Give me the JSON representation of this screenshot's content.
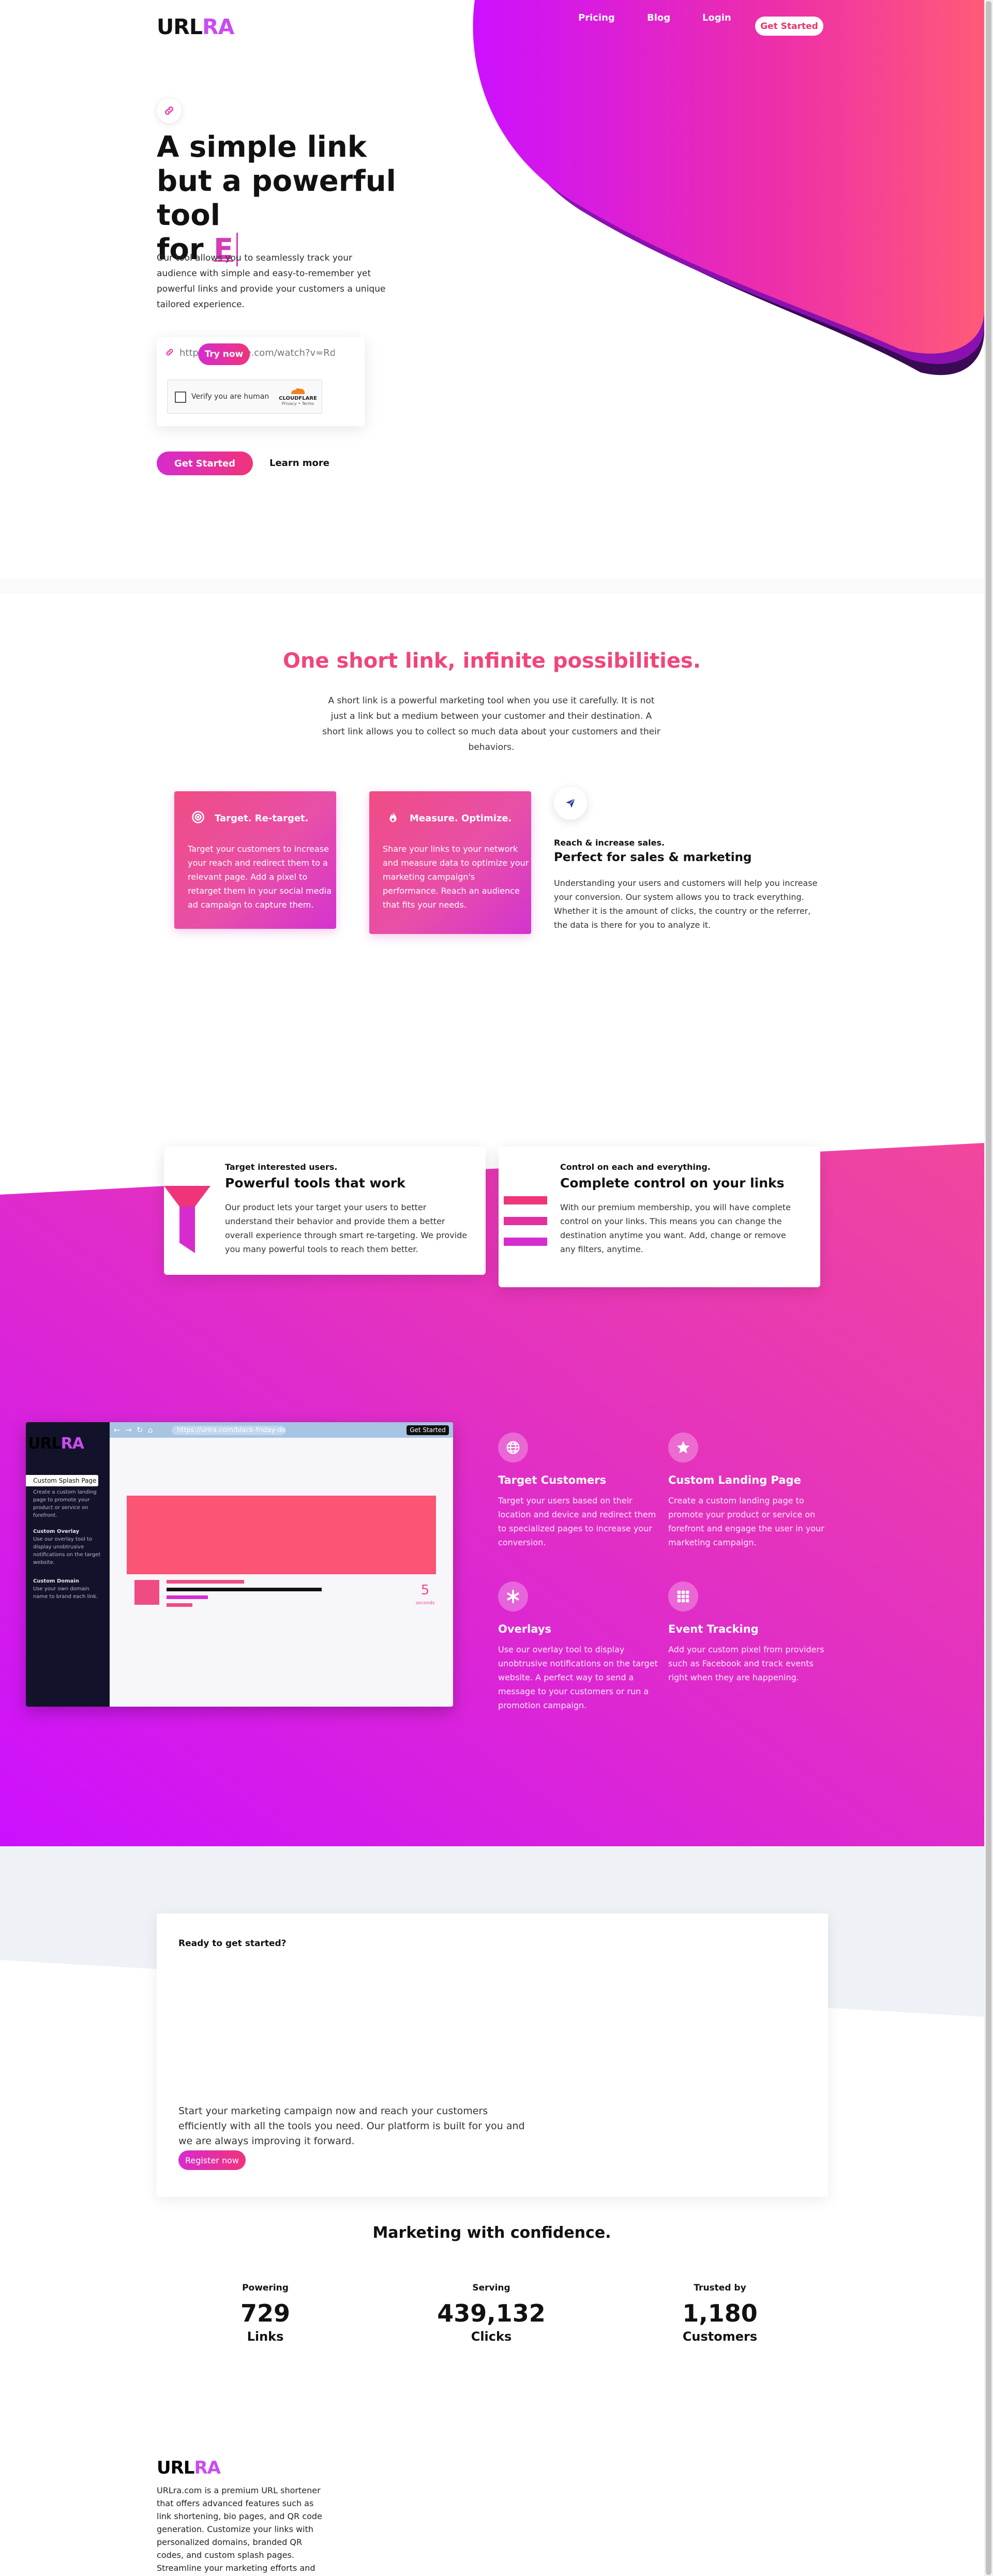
{
  "colors": {
    "pink": "#f0467a",
    "magenta": "#d62cce",
    "purple": "#c94cf0",
    "dark": "#111111"
  },
  "header": {
    "logo_part1": "URL",
    "logo_part2": "RA",
    "nav": [
      "Pricing",
      "Blog",
      "Login"
    ],
    "cta": "Get Started"
  },
  "hero": {
    "title_line1": "A simple link",
    "title_line2": "but a powerful tool",
    "title_line3_prefix": "for",
    "title_typed": "E",
    "description": "Our tool allows you to seamlessly track your audience with simple and easy-to-remember yet powerful links and provide your customers a unique tailored experience.",
    "input_placeholder": "https://youtube.com/watch?v=Rdb",
    "try_button": "Try now",
    "captcha_label": "Verify you are human",
    "captcha_brand": "CLOUDFLARE",
    "captcha_links": "Privacy • Terms",
    "primary_button": "Get Started",
    "secondary_link": "Learn more",
    "link_icon": "link-icon"
  },
  "possibilities": {
    "title": "One short link, infinite possibilities.",
    "description": "A short link is a powerful marketing tool when you use it carefully. It is not just a link but a medium between your customer and their destination. A short link allows you to collect so much data about your customers and their behaviors.",
    "cards": [
      {
        "icon": "target-icon",
        "title": "Target. Re-target.",
        "body": "Target your customers to increase your reach and redirect them to a relevant page. Add a pixel to retarget them in your social media ad campaign to capture them."
      },
      {
        "icon": "fire-icon",
        "title": "Measure. Optimize.",
        "body": "Share your links to your network and measure data to optimize your marketing campaign's performance. Reach an audience that fits your needs."
      }
    ],
    "sales": {
      "icon": "paper-plane-icon",
      "kicker": "Reach & increase sales.",
      "title": "Perfect for sales & marketing",
      "body": "Understanding your users and customers will help you increase your conversion. Our system allows you to track everything. Whether it is the amount of clicks, the country or the referrer, the data is there for you to analyze it."
    }
  },
  "tools": {
    "card1": {
      "kicker": "Target interested users.",
      "title": "Powerful tools that work",
      "body": "Our product lets your target your users to better understand their behavior and provide them a better overall experience through smart re-targeting. We provide you many powerful tools to reach them better.",
      "icon": "funnel-icon"
    },
    "card2": {
      "kicker": "Control on each and everything.",
      "title": "Complete control on your links",
      "body": "With our premium membership, you will have complete control on your links. This means you can change the destination anytime you want. Add, change or remove any filters, anytime.",
      "icon": "sliders-icon"
    }
  },
  "browser_mock": {
    "url": "https://urlra.com/black-friday-deals-link",
    "cta": "Get Started",
    "logo_part1": "URL",
    "logo_part2": "RA",
    "active_item": "Custom Splash Page",
    "active_desc": "Create a custom landing page to promote your product or service on forefront.",
    "items": [
      {
        "title": "Custom Overlay",
        "desc": "Use our overlay tool to display unobtrusive notifications on the target website."
      },
      {
        "title": "Custom Domain",
        "desc": "Use your own domain name to brand each link."
      }
    ],
    "countdown": "5",
    "countdown_label": "seconds"
  },
  "features": [
    {
      "icon": "globe-icon",
      "title": "Target Customers",
      "body": "Target your users based on their location and device and redirect them to specialized pages to increase your conversion."
    },
    {
      "icon": "star-icon",
      "title": "Custom Landing Page",
      "body": "Create a custom landing page to promote your product or service on forefront and engage the user in your marketing campaign."
    },
    {
      "icon": "asterisk-icon",
      "title": "Overlays",
      "body": "Use our overlay tool to display unobtrusive notifications on the target website. A perfect way to send a message to your customers or run a promotion campaign."
    },
    {
      "icon": "grid-icon",
      "title": "Event Tracking",
      "body": "Add your custom pixel from providers such as Facebook and track events right when they are happening."
    }
  ],
  "ready": {
    "kicker": "Ready to get started?",
    "body": "Start your marketing campaign now and reach your customers efficiently with all the tools you need. Our platform is built for you and we are always improving it forward.",
    "button": "Register now"
  },
  "stats": {
    "title": "Marketing with confidence.",
    "items": [
      {
        "label": "Powering",
        "value": "729",
        "unit": "Links"
      },
      {
        "label": "Serving",
        "value": "439,132",
        "unit": "Clicks"
      },
      {
        "label": "Trusted by",
        "value": "1,180",
        "unit": "Customers"
      }
    ]
  },
  "footer": {
    "logo_part1": "URL",
    "logo_part2": "RA",
    "description": "URLra.com is a premium URL shortener that offers advanced features such as link shortening, bio pages, and QR code generation. Customize your links with personalized domains, branded QR codes, and custom splash pages. Streamline your marketing efforts and elevate your online presence with"
  }
}
